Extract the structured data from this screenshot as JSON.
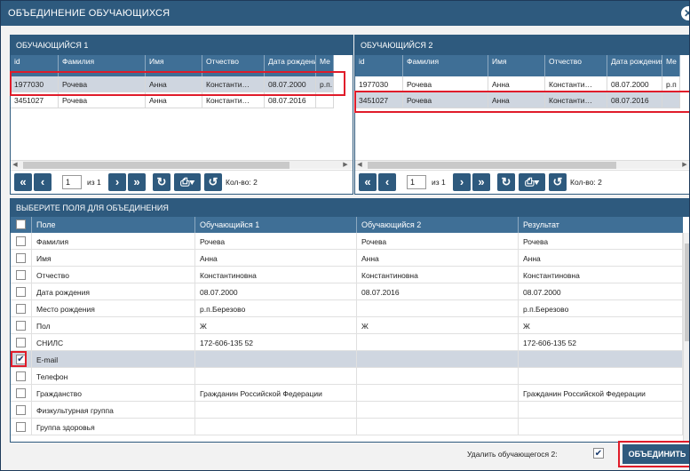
{
  "window": {
    "title": "ОБЪЕДИНЕНИЕ ОБУЧАЮЩИХСЯ",
    "close_glyph": "✕"
  },
  "student1": {
    "header": "ОБУЧАЮЩИЙСЯ 1",
    "columns": [
      "id",
      "Фамилия",
      "Имя",
      "Отчество",
      "Дата рождения",
      "Ме"
    ],
    "rows": [
      [
        "1977030",
        "Рочева",
        "Анна",
        "Константи…",
        "08.07.2000",
        "р.п."
      ],
      [
        "3451027",
        "Рочева",
        "Анна",
        "Константи…",
        "08.07.2016",
        ""
      ]
    ],
    "selected_row": 0,
    "pager": {
      "page": "1",
      "of_label": "из 1",
      "count_label": "Кол-во: 2"
    }
  },
  "student2": {
    "header": "ОБУЧАЮЩИЙСЯ 2",
    "columns": [
      "id",
      "Фамилия",
      "Имя",
      "Отчество",
      "Дата рождения",
      "Ме"
    ],
    "rows": [
      [
        "1977030",
        "Рочева",
        "Анна",
        "Константи…",
        "08.07.2000",
        "р.п"
      ],
      [
        "3451027",
        "Рочева",
        "Анна",
        "Константи…",
        "08.07.2016",
        ""
      ]
    ],
    "selected_row": 1,
    "pager": {
      "page": "1",
      "of_label": "из 1",
      "count_label": "Кол-во: 2"
    }
  },
  "fields": {
    "header": "ВЫБЕРИТЕ ПОЛЯ ДЛЯ ОБЪЕДИНЕНИЯ",
    "columns": [
      "Поле",
      "Обучающийся 1",
      "Обучающийся 2",
      "Результат"
    ],
    "rows": [
      {
        "field": "Фамилия",
        "s1": "Рочева",
        "s2": "Рочева",
        "res": "Рочева",
        "checked": false
      },
      {
        "field": "Имя",
        "s1": "Анна",
        "s2": "Анна",
        "res": "Анна",
        "checked": false
      },
      {
        "field": "Отчество",
        "s1": "Константиновна",
        "s2": "Константиновна",
        "res": "Константиновна",
        "checked": false
      },
      {
        "field": "Дата рождения",
        "s1": "08.07.2000",
        "s2": "08.07.2016",
        "res": "08.07.2000",
        "checked": false
      },
      {
        "field": "Место рождения",
        "s1": "р.п.Березово",
        "s2": "",
        "res": "р.п.Березово",
        "checked": false
      },
      {
        "field": "Пол",
        "s1": "Ж",
        "s2": "Ж",
        "res": "Ж",
        "checked": false
      },
      {
        "field": "СНИЛС",
        "s1": "172-606-135 52",
        "s2": "",
        "res": "172-606-135 52",
        "checked": false
      },
      {
        "field": "E-mail",
        "s1": "",
        "s2": "",
        "res": "",
        "checked": true
      },
      {
        "field": "Телефон",
        "s1": "",
        "s2": "",
        "res": "",
        "checked": false
      },
      {
        "field": "Гражданство",
        "s1": "Гражданин Российской Федерации",
        "s2": "",
        "res": "Гражданин Российской Федерации",
        "checked": false
      },
      {
        "field": "Физкультурная группа",
        "s1": "",
        "s2": "",
        "res": "",
        "checked": false
      },
      {
        "field": "Группа здоровья",
        "s1": "",
        "s2": "",
        "res": "",
        "checked": false
      }
    ]
  },
  "footer": {
    "delete_label": "Удалить обучающегося 2:",
    "delete_checked": true,
    "merge_label": "ОБЪЕДИНИТЬ"
  },
  "colors": {
    "accent": "#2e5a7e",
    "header": "#3f6f96",
    "highlight": "#e01c2a",
    "selected": "#cfd6e0"
  }
}
